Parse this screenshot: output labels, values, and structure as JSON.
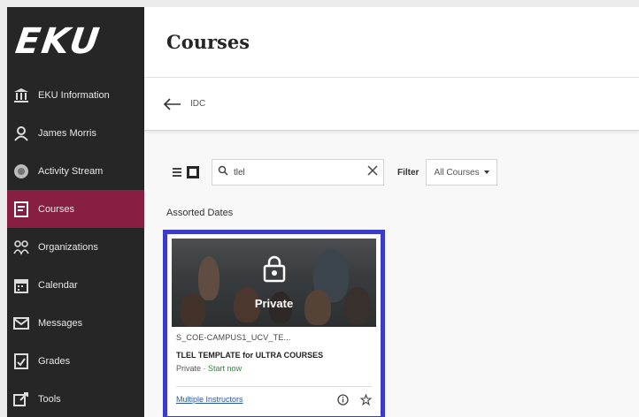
{
  "brand": {
    "logo_text": "EKU"
  },
  "sidebar": {
    "items": [
      {
        "label": "EKU Information",
        "icon": "institution-icon",
        "active": false
      },
      {
        "label": "James Morris",
        "icon": "user-icon",
        "active": false
      },
      {
        "label": "Activity Stream",
        "icon": "activity-stream-icon",
        "active": false
      },
      {
        "label": "Courses",
        "icon": "courses-icon",
        "active": true
      },
      {
        "label": "Organizations",
        "icon": "organizations-icon",
        "active": false
      },
      {
        "label": "Calendar",
        "icon": "calendar-icon",
        "active": false
      },
      {
        "label": "Messages",
        "icon": "messages-icon",
        "active": false
      },
      {
        "label": "Grades",
        "icon": "grades-icon",
        "active": false
      },
      {
        "label": "Tools",
        "icon": "tools-icon",
        "active": false
      }
    ]
  },
  "header": {
    "title": "Courses"
  },
  "breadcrumb": {
    "label": "IDC"
  },
  "toolbar": {
    "search_value": "tlel",
    "filter_label": "Filter",
    "filter_value": "All Courses"
  },
  "section": {
    "heading": "Assorted Dates"
  },
  "course_card": {
    "overlay_label": "Private",
    "course_id": "S_COE-CAMPUS1_UCV_TE...",
    "course_name": "TLEL TEMPLATE for ULTRA COURSES",
    "status": "Private",
    "separator": "·",
    "action": "Start now",
    "instructors": "Multiple Instructors"
  },
  "colors": {
    "sidebar_bg": "#262626",
    "active_nav": "#861f41",
    "card_highlight": "#3a3cc8",
    "link": "#2b57a8",
    "start_now": "#2a8a3a"
  }
}
